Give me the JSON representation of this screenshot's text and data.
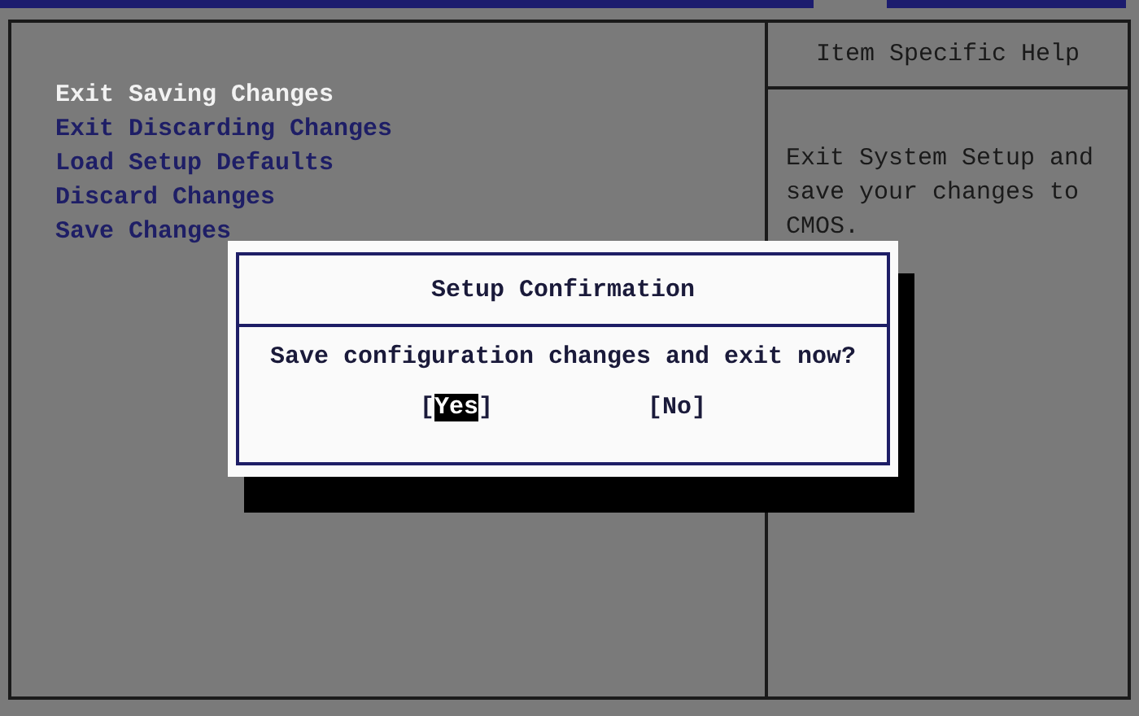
{
  "menu_items": [
    {
      "label": "Exit Saving Changes",
      "selected": true
    },
    {
      "label": "Exit Discarding Changes",
      "selected": false
    },
    {
      "label": "Load Setup Defaults",
      "selected": false
    },
    {
      "label": "Discard Changes",
      "selected": false
    },
    {
      "label": "Save Changes",
      "selected": false
    }
  ],
  "help_panel": {
    "title": "Item Specific Help",
    "text": "Exit System Setup and save your changes to CMOS."
  },
  "dialog": {
    "title": "Setup Confirmation",
    "message": "Save configuration changes and exit now?",
    "buttons": [
      {
        "open": "[",
        "label": "Yes",
        "close": "]",
        "selected": true
      },
      {
        "open": "[",
        "label": "No",
        "close": "]",
        "selected": false
      }
    ]
  }
}
